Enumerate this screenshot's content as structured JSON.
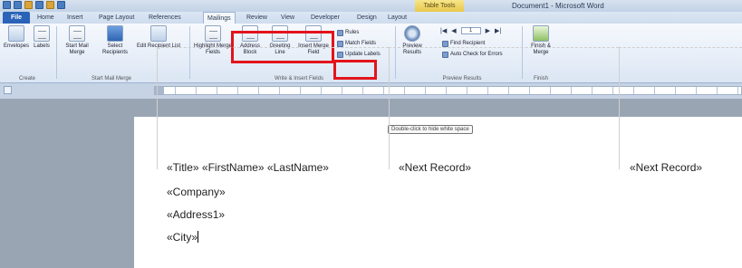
{
  "titlebar": {
    "context_tab": "Table Tools",
    "document_title": "Document1 - Microsoft Word"
  },
  "tabs": [
    "File",
    "Home",
    "Insert",
    "Page Layout",
    "References",
    "Mailings",
    "Review",
    "View",
    "Developer",
    "Design",
    "Layout"
  ],
  "active_tab": "Mailings",
  "ribbon": {
    "create": {
      "envelopes": "Envelopes",
      "labels": "Labels",
      "group": "Create"
    },
    "start_mail_merge": {
      "start": "Start Mail Merge",
      "select": "Select Recipients",
      "edit": "Edit Recipient List",
      "group": "Start Mail Merge"
    },
    "write_insert": {
      "highlight": "Highlight Merge Fields",
      "address_block": "Address Block",
      "greeting_line": "Greeting Line",
      "insert_merge_field": "Insert Merge Field",
      "rules": "Rules",
      "match_fields": "Match Fields",
      "update_labels": "Update Labels",
      "group": "Write & Insert Fields"
    },
    "preview": {
      "preview_results": "Preview Results",
      "record": "1",
      "find_recipient": "Find Recipient",
      "auto_check": "Auto Check for Errors",
      "group": "Preview Results"
    },
    "finish": {
      "finish_merge": "Finish & Merge",
      "group": "Finish"
    }
  },
  "tooltip": "Double-click to hide white space",
  "document": {
    "cell1": {
      "line1": "«Title» «FirstName» «LastName»",
      "line2": "«Company»",
      "line3": "«Address1»",
      "line4": "«City»"
    },
    "cell2": "«Next Record»",
    "cell3": "«Next Record»"
  },
  "colors": {
    "highlight_box": "#e3131c",
    "file_tab": "#2a63b8",
    "context_tab": "#e8c84c"
  }
}
